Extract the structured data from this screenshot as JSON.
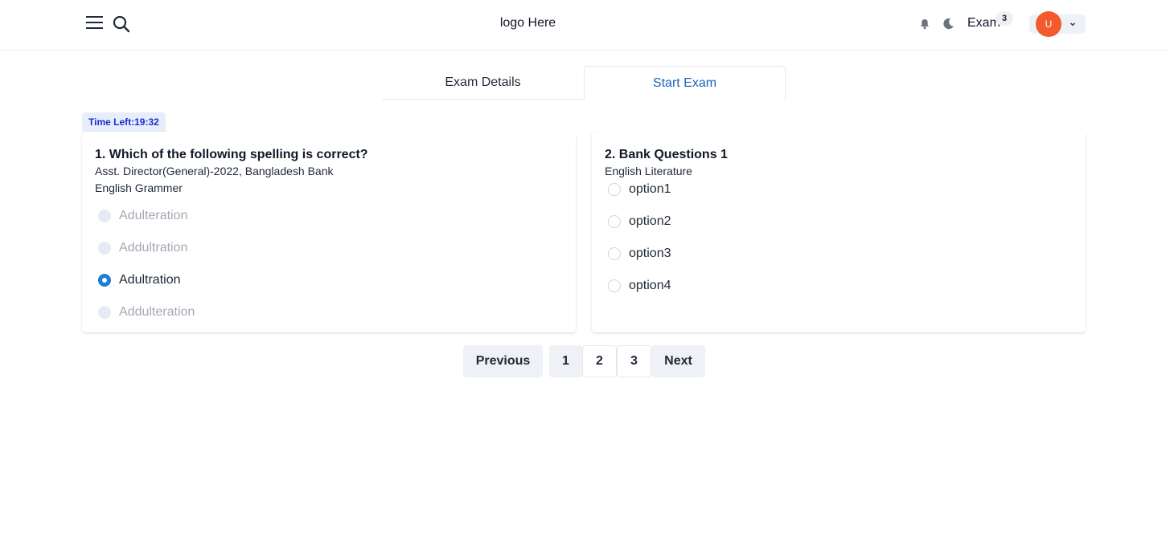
{
  "header": {
    "logo": "logo Here",
    "exam_label": "Exam",
    "exam_count": "3",
    "avatar_initial": "U"
  },
  "tabs": [
    {
      "label": "Exam Details",
      "active": false
    },
    {
      "label": "Start Exam",
      "active": true
    }
  ],
  "timer": "Time Left:19:32",
  "questions": [
    {
      "title": "1. Which of the following spelling is correct?",
      "source": "Asst. Director(General)-2022, Bangladesh Bank",
      "subject": "English Grammer",
      "options": [
        {
          "label": "Adulteration",
          "state": "disabled"
        },
        {
          "label": "Addultration",
          "state": "disabled"
        },
        {
          "label": "Adultration",
          "state": "selected"
        },
        {
          "label": "Addulteration",
          "state": "disabled"
        }
      ]
    },
    {
      "title": "2. Bank Questions 1",
      "subject": "English Literature",
      "options": [
        {
          "label": "option1",
          "state": "unselected"
        },
        {
          "label": "option2",
          "state": "unselected"
        },
        {
          "label": "option3",
          "state": "unselected"
        },
        {
          "label": "option4",
          "state": "unselected"
        }
      ]
    }
  ],
  "pagination": {
    "previous": "Previous",
    "pages": [
      "1",
      "2",
      "3"
    ],
    "current_page": "1",
    "next": "Next"
  },
  "colors": {
    "accent": "#1c64b7",
    "radio_selected": "#1c7ed6",
    "avatar_bg": "#f35b2c",
    "timer_text": "#1d2bd6"
  }
}
